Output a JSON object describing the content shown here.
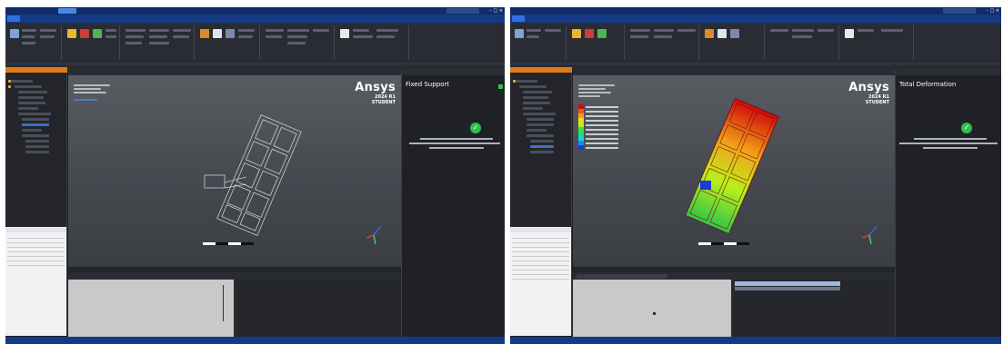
{
  "left": {
    "logo": {
      "word": "Ansys",
      "version": "2024 R1",
      "edition": "STUDENT"
    },
    "side_panel": {
      "title": "Fixed Support"
    },
    "tree_selected": "Fixed Support"
  },
  "right": {
    "logo": {
      "word": "Ansys",
      "version": "2024 R1",
      "edition": "STUDENT"
    },
    "side_panel": {
      "title": "Total Deformation"
    }
  },
  "colors": {
    "titlebar": "#0f2e69",
    "menubar": "#143a86",
    "accent_orange": "#e07b1a",
    "ok_green": "#2fc14b",
    "legend": [
      "#d10a0a",
      "#f2541a",
      "#ff9c1f",
      "#f0de1a",
      "#b9f01a",
      "#4fe02a",
      "#1ae07a",
      "#1ad4d4",
      "#1a8ef0",
      "#1a3cf0"
    ]
  },
  "icons": [
    "file-icon",
    "success-check-icon",
    "axis-triad-icon",
    "minimize-icon",
    "maximize-icon",
    "close-icon"
  ]
}
